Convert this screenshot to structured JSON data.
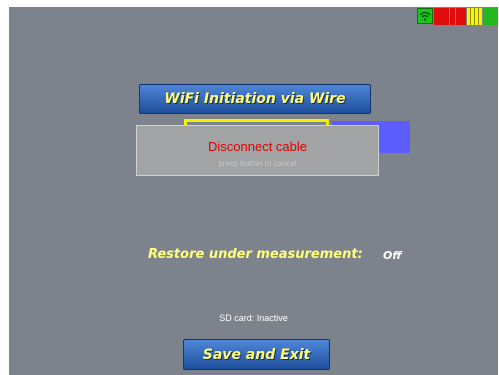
{
  "wifi_button_label": "WiFi Initiation via Wire",
  "dialog": {
    "title": "Disconnect cable",
    "subtitle": "press button to cancel"
  },
  "restore": {
    "label": "Restore under measurement:",
    "value": "Off"
  },
  "sd_status": "SD card: Inactive",
  "save_button_label": "Save and Exit",
  "status_icons": {
    "wifi": "wifi-icon",
    "battery": "battery-level-icon"
  },
  "colors": {
    "screen_background": "#7d838c",
    "button_blue": "#2f66bd",
    "label_yellow": "#ffff7b",
    "dialog_text_red": "#e20000",
    "highlight_yellow": "#f3f000",
    "accent_blue": "#5d5dff",
    "wifi_green": "#19c61d"
  }
}
